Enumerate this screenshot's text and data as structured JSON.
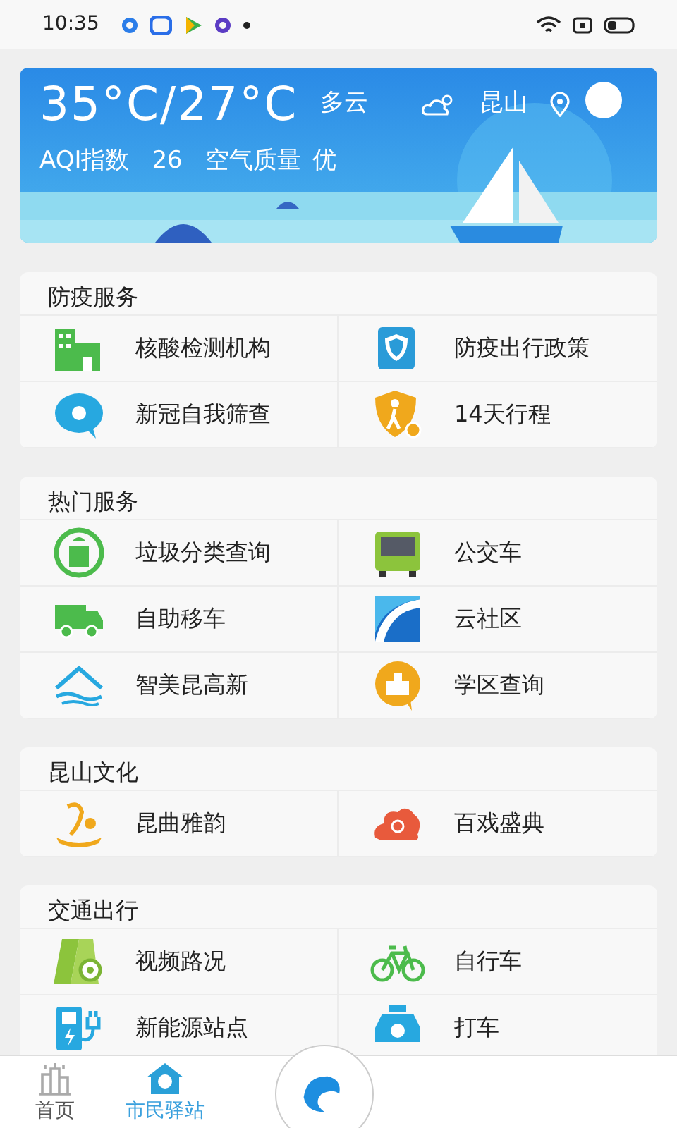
{
  "status_bar": {
    "time": "10:35"
  },
  "weather": {
    "temperature": "35°C/27°C",
    "condition": "多云",
    "city": "昆山",
    "aqi_label": "AQI指数",
    "aqi_value": "26",
    "quality_label": "空气质量",
    "quality_value": "优"
  },
  "sections": [
    {
      "title": "防疫服务",
      "items": [
        {
          "label": "核酸检测机构"
        },
        {
          "label": "防疫出行政策"
        },
        {
          "label": "新冠自我筛查"
        },
        {
          "label": "14天行程"
        }
      ]
    },
    {
      "title": "热门服务",
      "items": [
        {
          "label": "垃圾分类查询"
        },
        {
          "label": "公交车"
        },
        {
          "label": "自助移车"
        },
        {
          "label": "云社区"
        },
        {
          "label": "智美昆高新"
        },
        {
          "label": "学区查询"
        }
      ]
    },
    {
      "title": "昆山文化",
      "items": [
        {
          "label": "昆曲雅韵"
        },
        {
          "label": "百戏盛典"
        }
      ]
    },
    {
      "title": "交通出行",
      "items": [
        {
          "label": "视频路况"
        },
        {
          "label": "自行车"
        },
        {
          "label": "新能源站点"
        },
        {
          "label": "打车"
        }
      ]
    }
  ],
  "bottom_nav": [
    {
      "label": "首页",
      "selected": false
    },
    {
      "label": "市民驿站",
      "selected": true
    }
  ]
}
